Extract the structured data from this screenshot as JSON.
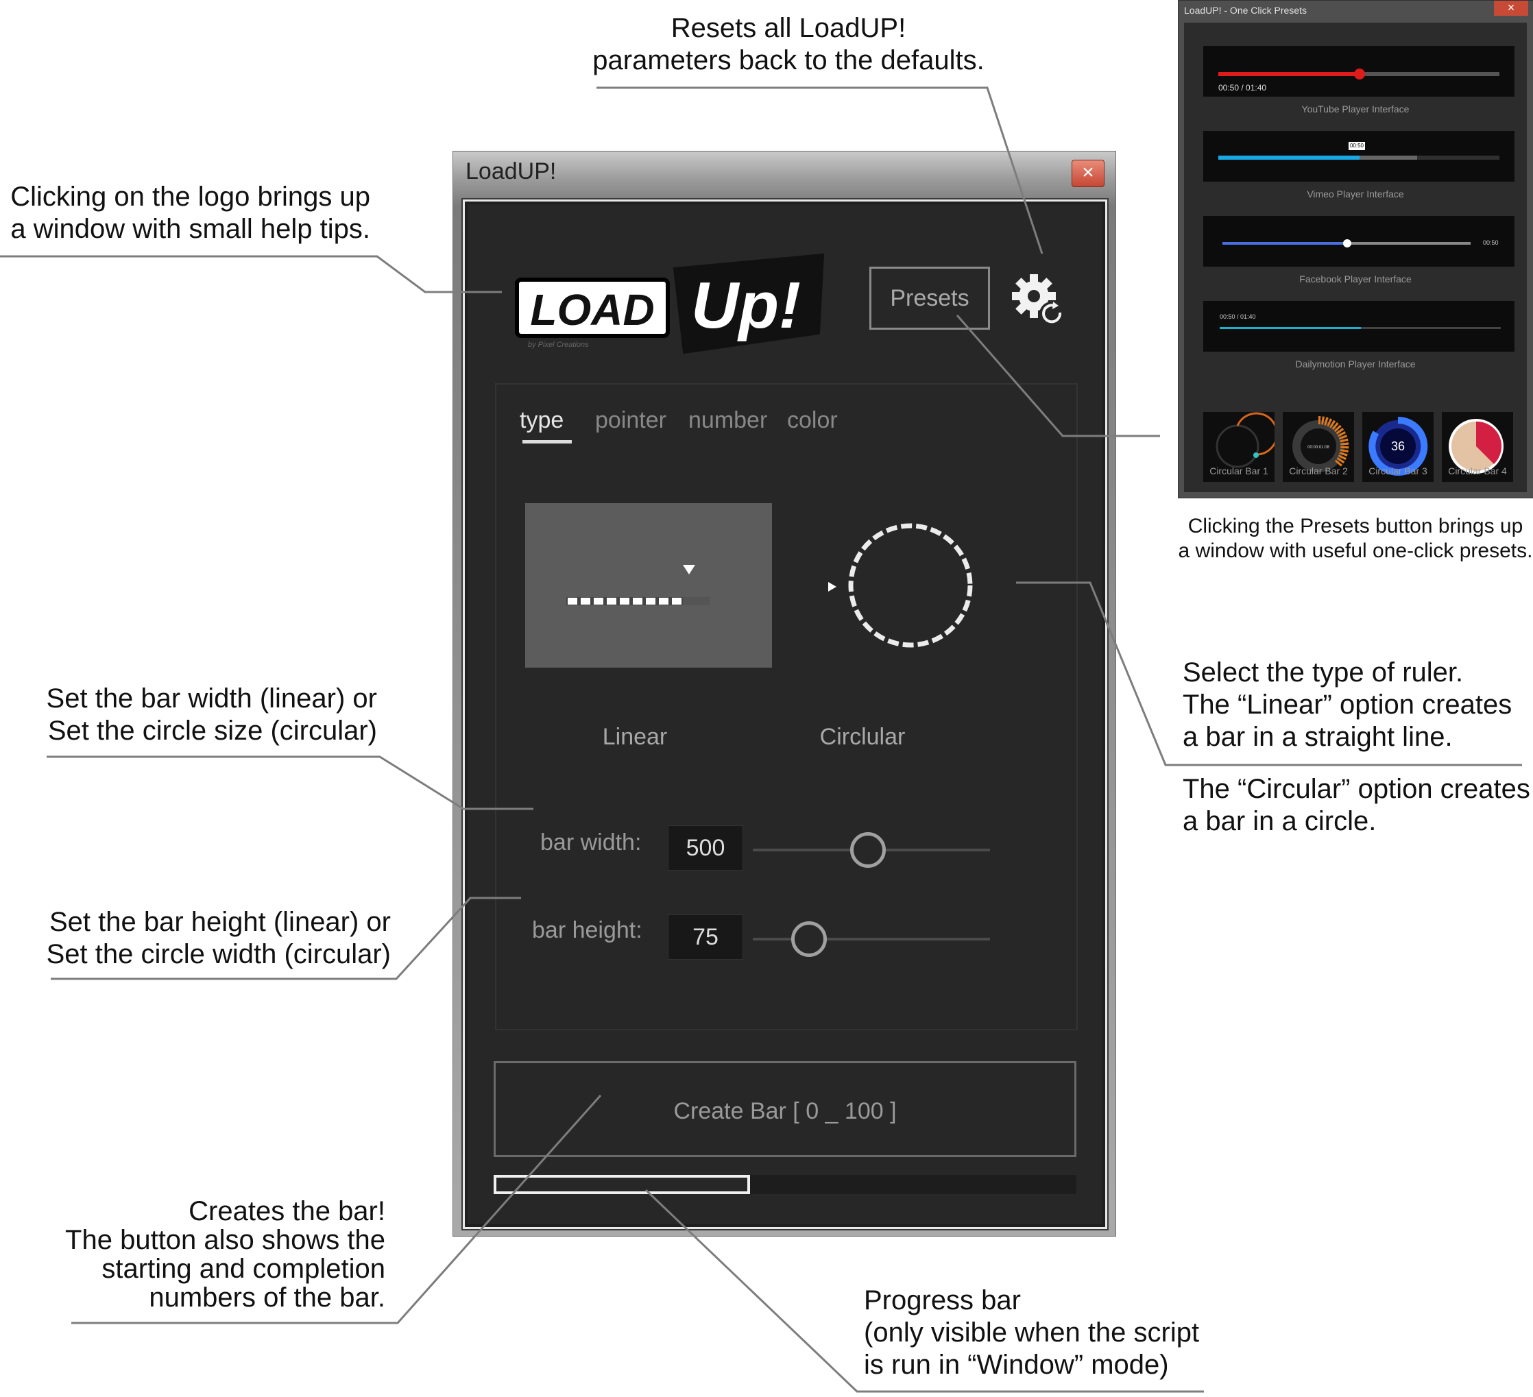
{
  "window": {
    "title": "LoadUP!",
    "close": "×",
    "logo_left": "LOAD",
    "logo_right": "Up!",
    "logo_byline": "by Pixel Creations",
    "presets_label": "Presets",
    "tabs": [
      {
        "label": "type"
      },
      {
        "label": "pointer"
      },
      {
        "label": "number"
      },
      {
        "label": "color"
      }
    ],
    "type_options": [
      {
        "label": "Linear"
      },
      {
        "label": "Circlular"
      }
    ],
    "bar_width": {
      "label": "bar width:",
      "value": "500"
    },
    "bar_height": {
      "label": "bar height:",
      "value": "75"
    },
    "create_button": "Create Bar [ 0 _ 100 ]",
    "progress": 0.44
  },
  "presets_window": {
    "title": "LoadUP! - One Click Presets",
    "close": "×",
    "youtube_time": "00:50 / 01:40",
    "youtube_label": "YouTube Player Interface",
    "vimeo_time": "00:50",
    "vimeo_label": "Vimeo Player Interface",
    "facebook_time": "00:50",
    "facebook_label": "Facebook Player Interface",
    "dailymotion_time": "00:50 / 01:40",
    "dailymotion_label": "Dailymotion Player Interface",
    "circular": [
      {
        "label": "Circular Bar 1"
      },
      {
        "label": "Circular Bar 2",
        "inner": "00:00:01:08"
      },
      {
        "label": "Circular Bar 3",
        "inner": "36"
      },
      {
        "label": "Circular Bar 4"
      }
    ]
  },
  "annotations": {
    "reset": "Resets all LoadUP!\nparameters back to the defaults.",
    "logo": "Clicking on the logo brings up\na window with small help tips.",
    "presets": "Clicking the Presets button brings up\na window with useful one-click presets.",
    "type": "Select the type of ruler.\nThe “Linear” option creates\na bar in a straight line.",
    "circular": "The “Circular” option creates\na bar in a circle.",
    "width": "Set the bar width (linear) or\nSet the circle size (circular)",
    "height": "Set the bar height (linear) or\nSet the circle width (circular)",
    "create": "Creates the bar!\nThe button also shows the\nstarting and completion\nnumbers of the bar.",
    "progress": "Progress bar\n(only visible when the script\nis run in “Window” mode)"
  }
}
